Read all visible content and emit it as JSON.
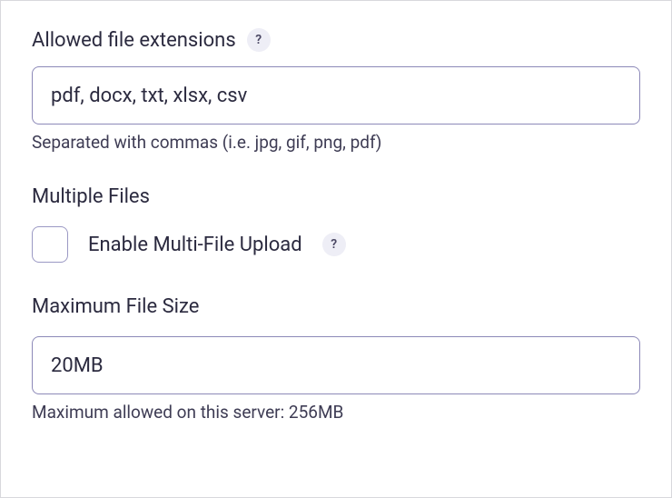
{
  "extensions": {
    "label": "Allowed file extensions",
    "value": "pdf, docx, txt, xlsx, csv",
    "hint": "Separated with commas (i.e. jpg, gif, png, pdf)"
  },
  "multiple": {
    "heading": "Multiple Files",
    "checkbox_label": "Enable Multi-File Upload",
    "checked": false
  },
  "maxsize": {
    "heading": "Maximum File Size",
    "value": "20MB",
    "hint": "Maximum allowed on this server: 256MB"
  },
  "help_glyph": "?"
}
